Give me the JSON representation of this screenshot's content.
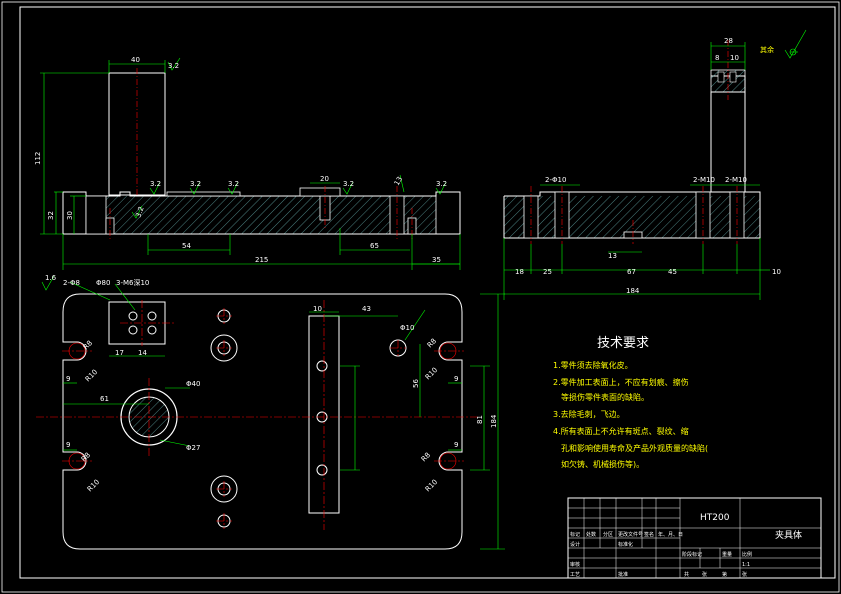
{
  "colors": {
    "background": "#000000",
    "outline": "#ffffff",
    "dimension": "#00ff00",
    "centerline": "#ff0000",
    "hatch": "#00ffff",
    "text": "#ffff00"
  },
  "front_view": {
    "dims": {
      "top_width": "40",
      "height_total": "112",
      "height_base": "32",
      "height_plate": "30",
      "step": "20",
      "left_54": "54",
      "right_65": "65",
      "overall_215": "215",
      "right_35": "35"
    },
    "roughness": [
      "3.2",
      "3.2",
      "3.2",
      "3.2",
      "3.2",
      "3.2",
      "3.2"
    ],
    "hole_label": "13"
  },
  "side_view": {
    "dims": {
      "top_28": "28",
      "top_8": "8",
      "top_10": "10",
      "hole_a": "2-Φ10",
      "hole_b": "2-M10",
      "hole_c": "2-M10",
      "bottom_13": "13",
      "b_18": "18",
      "b_25": "25",
      "b_67": "67",
      "b_45": "45",
      "b_10": "10",
      "overall_184": "184"
    },
    "roughness_note": "其余"
  },
  "top_view": {
    "labels": {
      "roughness_tl": "1.6",
      "hole_2phi": "2-Φ8",
      "phi_80": "Φ80",
      "m6": "3-M6深10",
      "d_17": "17",
      "d_14": "14",
      "r8_a": "R8",
      "r10_a": "R10",
      "d_9a": "9",
      "d_61": "61",
      "phi_40": "Φ40",
      "phi_27": "Φ27",
      "d_9b": "9",
      "r8_b": "R8",
      "r10_b": "R10",
      "d_10": "10",
      "d_43": "43",
      "d_56": "56",
      "d_81": "81",
      "d_184": "184",
      "phi_10": "Φ10",
      "r8_c": "R8",
      "r10_c": "R10",
      "d_9c": "9",
      "d_9d": "9",
      "r8_d": "R8",
      "r10_d": "R10"
    }
  },
  "tech_req": {
    "title": "技术要求",
    "lines": [
      "1.零件须去除氧化皮。",
      "2.零件加工表面上，不应有划痕、擦伤",
      "等损伤零件表面的缺陷。",
      "3.去除毛刺，飞边。",
      "4.所有表面上不允许有斑点、裂纹、缩",
      "孔和影响使用寿命及产品外观质量的缺陷(",
      "如欠铸、机械损伤等)。"
    ]
  },
  "title_block": {
    "material": "HT200",
    "part_name": "夹具体",
    "scale": "1:1",
    "cells": [
      "标记",
      "处数",
      "分区",
      "更改文件号",
      "签名",
      "年、月、日",
      "设计",
      "标准化",
      "阶段标记",
      "重量",
      "比例",
      "审核",
      "工艺",
      "批准",
      "共",
      "张",
      "第",
      "张"
    ]
  }
}
